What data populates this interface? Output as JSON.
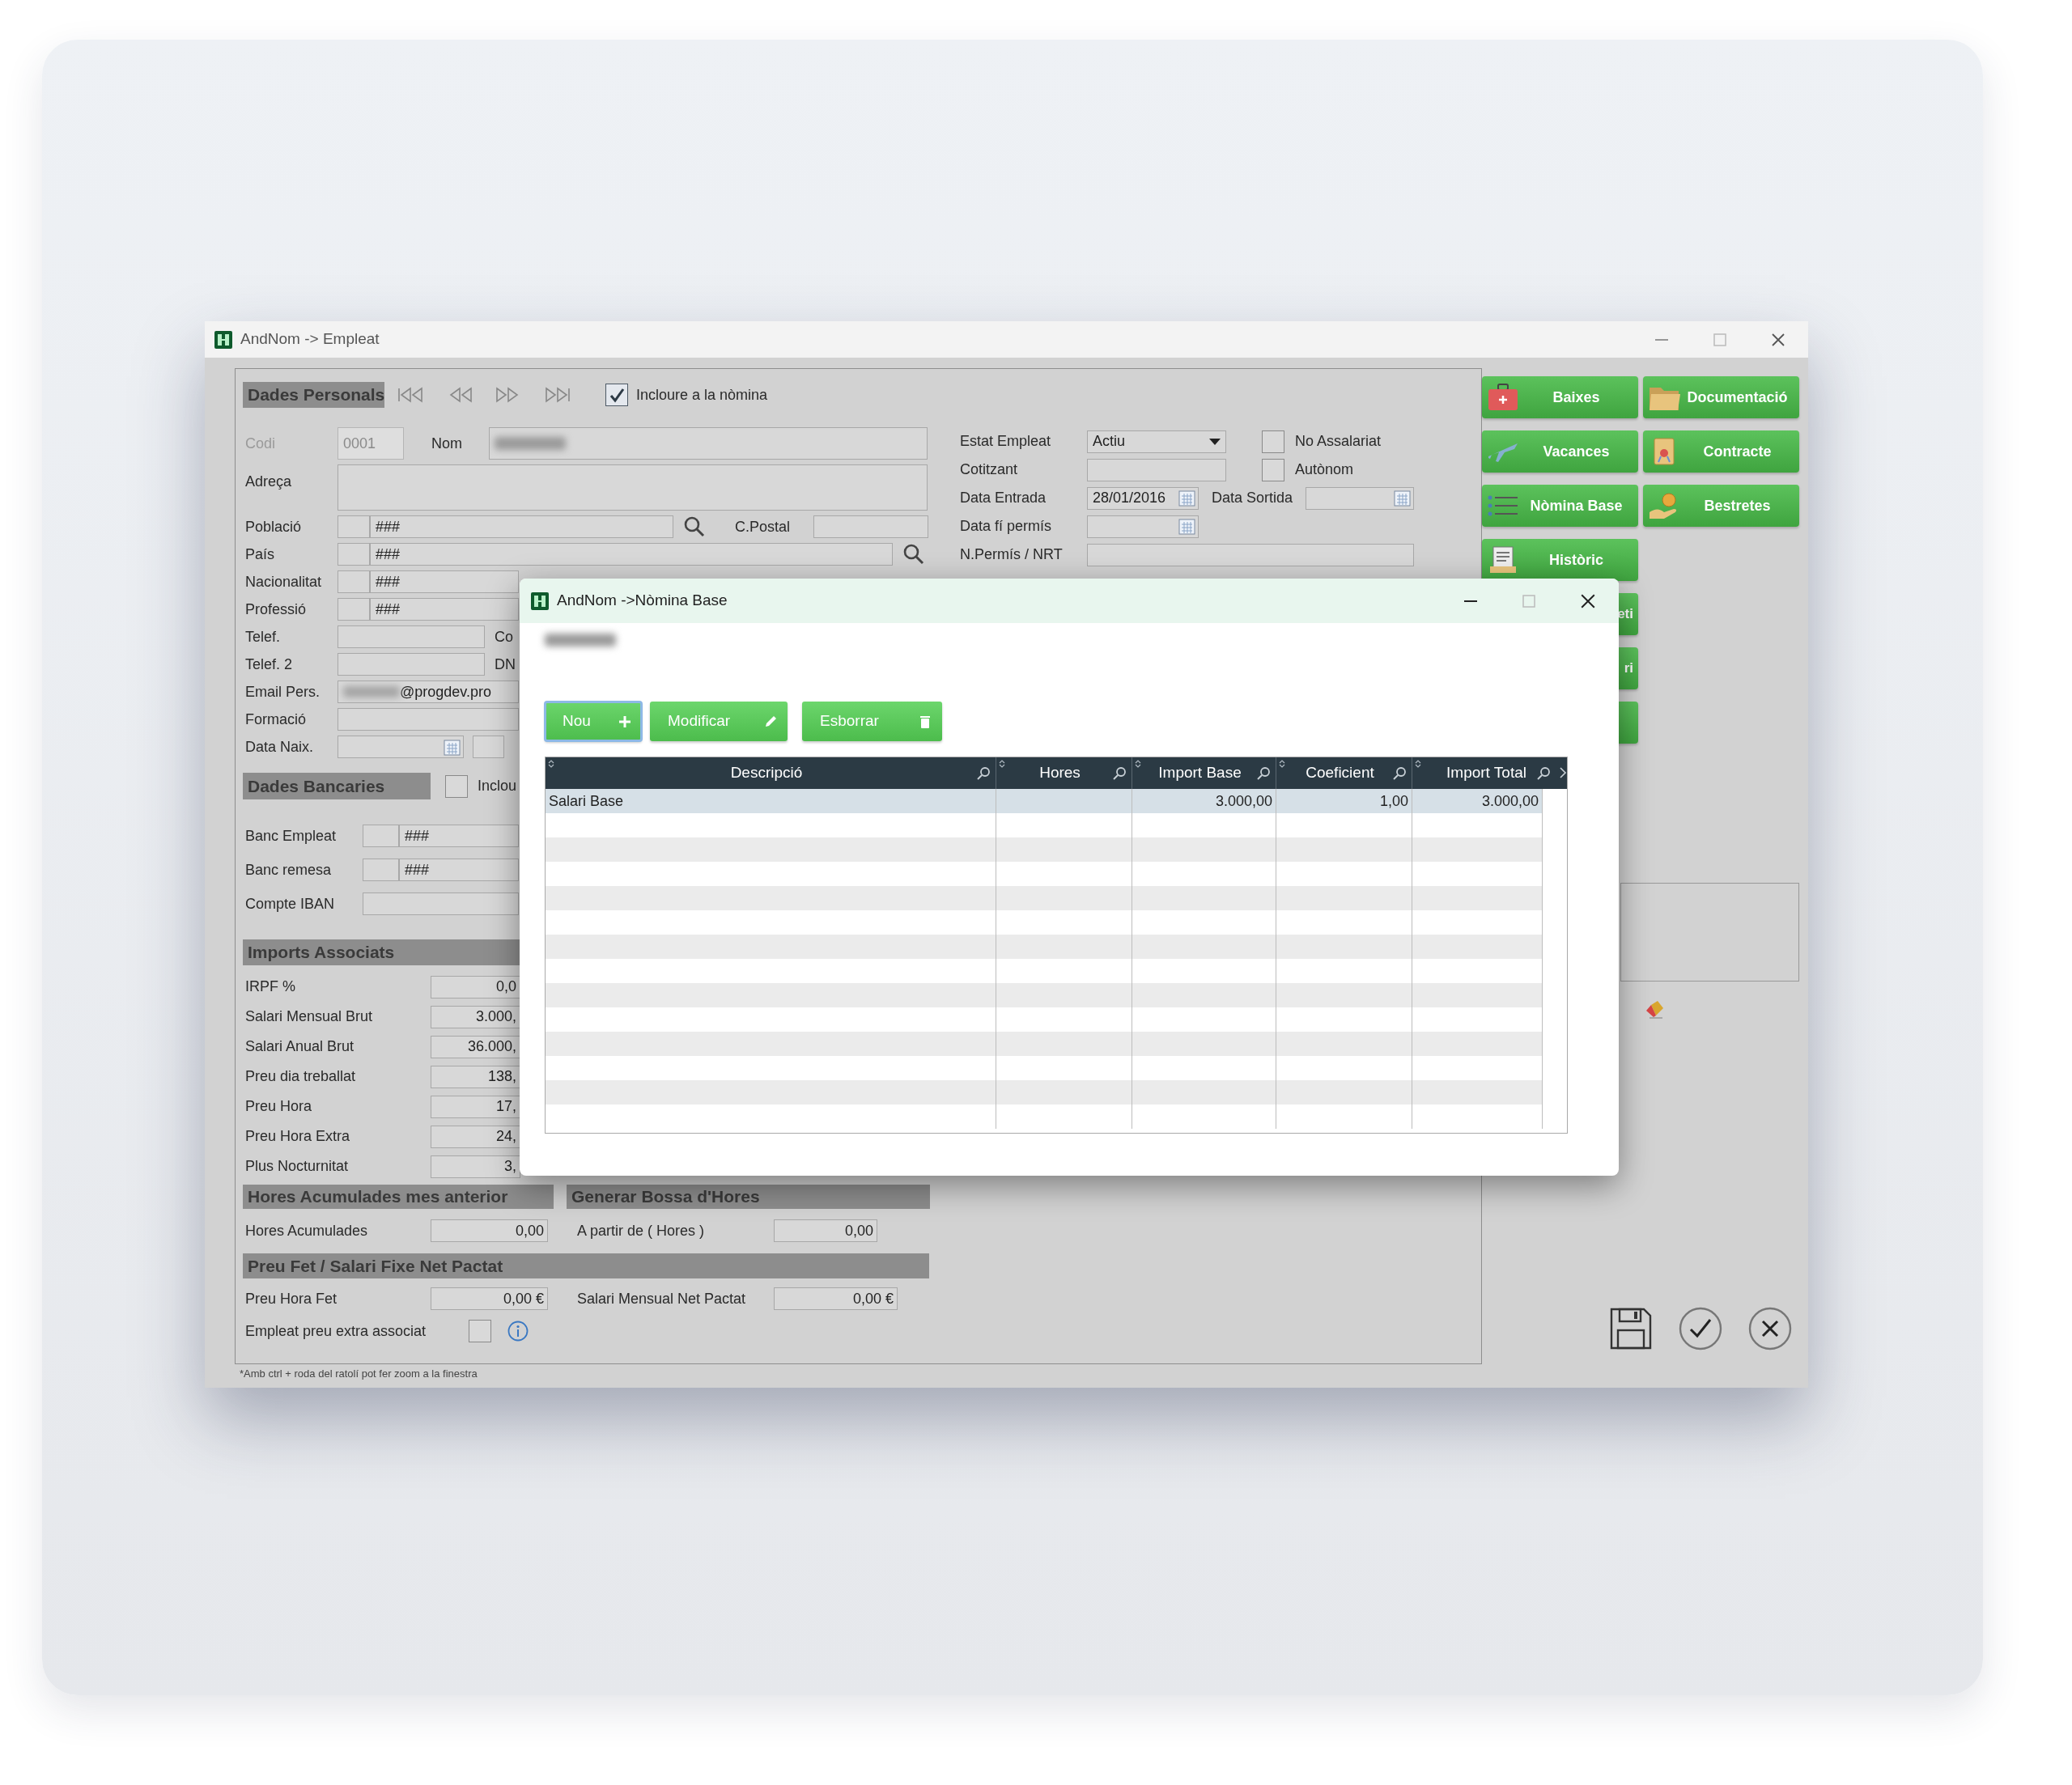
{
  "window": {
    "title": "AndNom -> Empleat"
  },
  "include_in_payroll": {
    "label": "Incloure a la nòmina",
    "checked": true
  },
  "personal": {
    "title": "Dades Personals",
    "codi": {
      "label": "Codi",
      "value": "0001",
      "disabled": true
    },
    "nom": {
      "label": "Nom",
      "redacted": true
    },
    "adreca": {
      "label": "Adreça"
    },
    "lookups": [
      {
        "label": "Població",
        "value": "###",
        "search": true,
        "postal": {
          "label": "C.Postal"
        }
      },
      {
        "label": "País",
        "value": "###",
        "search": true
      },
      {
        "label": "Nacionalitat",
        "value": "###",
        "search": false
      },
      {
        "label": "Professió",
        "value": "###",
        "search": false
      }
    ],
    "phones": [
      {
        "label": "Telef.",
        "side_label": "Co"
      },
      {
        "label": "Telef. 2",
        "side_label": "DN"
      }
    ],
    "email": {
      "label": "Email Pers.",
      "redacted": true,
      "value": "@progdev.pro"
    },
    "formacio": {
      "label": "Formació"
    },
    "birth": {
      "label": "Data Naix."
    }
  },
  "employment": {
    "rows": [
      {
        "label": "Estat Empleat",
        "kind": "select",
        "value": "Actiu"
      },
      {
        "label": "Cotitzant",
        "kind": "text"
      },
      {
        "label": "Data Entrada",
        "kind": "date",
        "value": "28/01/2016",
        "exit": {
          "label": "Data Sortida"
        }
      },
      {
        "label": "Data fí permís",
        "kind": "date"
      },
      {
        "label": "N.Permís / NRT",
        "kind": "wide"
      }
    ],
    "checks": [
      {
        "label": "No Assalariat",
        "checked": false
      },
      {
        "label": "Autònom",
        "checked": false
      }
    ]
  },
  "bank": {
    "title": "Dades Bancaries",
    "include": {
      "label": "Inclou",
      "checked": false
    },
    "rows": [
      {
        "label": "Banc Empleat",
        "kind": "lookup",
        "value": "###"
      },
      {
        "label": "Banc remesa",
        "kind": "lookup",
        "value": "###"
      },
      {
        "label": "Compte IBAN",
        "kind": "text"
      }
    ]
  },
  "amounts": {
    "title": "Imports Associats",
    "rows": [
      {
        "label": "IRPF %",
        "value": "0,0"
      },
      {
        "label": "Salari Mensual Brut",
        "value": "3.000,"
      },
      {
        "label": "Salari Anual Brut",
        "value": "36.000,"
      },
      {
        "label": "Preu dia treballat",
        "value": "138,"
      },
      {
        "label": "Preu Hora",
        "value": "17,"
      },
      {
        "label": "Preu Hora Extra",
        "value": "24,"
      },
      {
        "label": "Plus Nocturnitat",
        "value": "3,"
      }
    ]
  },
  "hours": {
    "titles": [
      "Hores Acumulades mes anterior",
      "Generar Bossa d'Hores"
    ],
    "fields": [
      {
        "label": "Hores Acumulades",
        "value": "0,00"
      },
      {
        "label": "A partir de ( Hores )",
        "value": "0,00"
      }
    ]
  },
  "piecework": {
    "title": "Preu Fet / Salari Fixe Net Pactat",
    "fields": [
      {
        "label": "Preu Hora Fet",
        "value": "0,00 €"
      },
      {
        "label": "Salari Mensual Net Pactat",
        "value": "0,00 €"
      }
    ],
    "extra": {
      "label": "Empleat preu extra associat",
      "checked": false
    }
  },
  "footnote": "*Amb ctrl + roda del ratolí pot fer zoom a la finestra",
  "side_button_rows": [
    [
      {
        "kind": "full",
        "label": "Baixes"
      },
      {
        "kind": "full",
        "label": "Documentació"
      }
    ],
    [
      {
        "kind": "full",
        "label": "Vacances"
      },
      {
        "kind": "full",
        "label": "Contracte"
      }
    ],
    [
      {
        "kind": "full",
        "label": "Nòmina Base"
      },
      {
        "kind": "full",
        "label": "Bestretes"
      }
    ],
    [
      {
        "kind": "full",
        "label": "Històric"
      }
    ],
    [
      {
        "kind": "covered",
        "label": "eti"
      }
    ],
    [
      {
        "kind": "covered",
        "label": "ri"
      }
    ],
    [
      {
        "kind": "blank"
      }
    ]
  ],
  "dialog": {
    "title": "AndNom ->Nòmina Base",
    "redacted_name": true,
    "buttons": [
      {
        "label": "Nou",
        "focused": true
      },
      {
        "label": "Modificar",
        "focused": false
      },
      {
        "label": "Esborrar",
        "focused": false
      }
    ],
    "table": {
      "columns": [
        "Descripció",
        "Hores",
        "Import Base",
        "Coeficient",
        "Import Total"
      ],
      "rows": [
        {
          "cells": [
            "Salari Base",
            null,
            "3.000,00",
            "1,00",
            "3.000,00"
          ],
          "selected": true
        }
      ]
    }
  }
}
